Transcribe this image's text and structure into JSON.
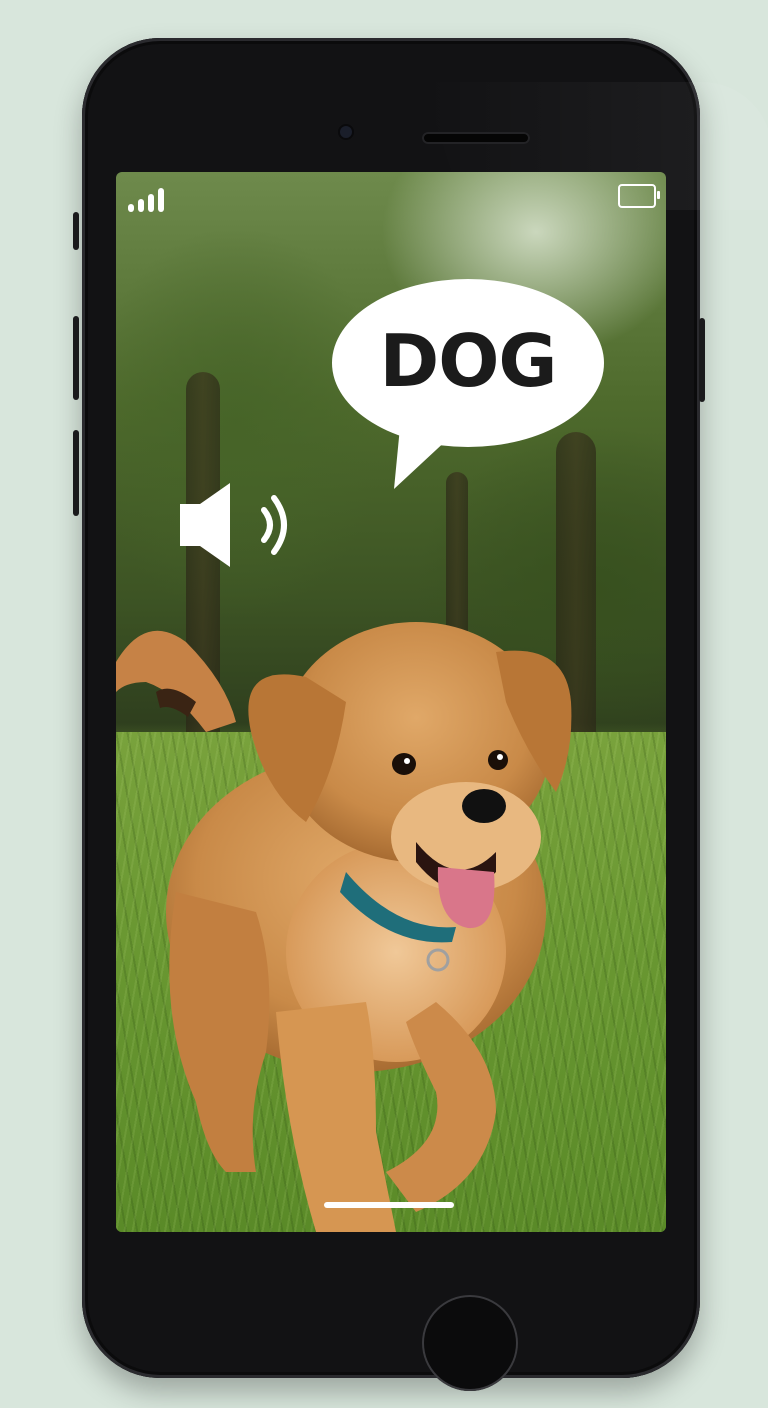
{
  "speech_bubble": {
    "text": "DOG"
  },
  "status_bar": {
    "signal_icon": "signal-strength-icon",
    "battery_icon": "battery-icon"
  },
  "audio": {
    "icon": "speaker-volume-icon"
  },
  "colors": {
    "background": "#d8e6dc",
    "phone_body": "#121214",
    "bubble_fill": "#ffffff",
    "bubble_text": "#1b1b1b"
  }
}
